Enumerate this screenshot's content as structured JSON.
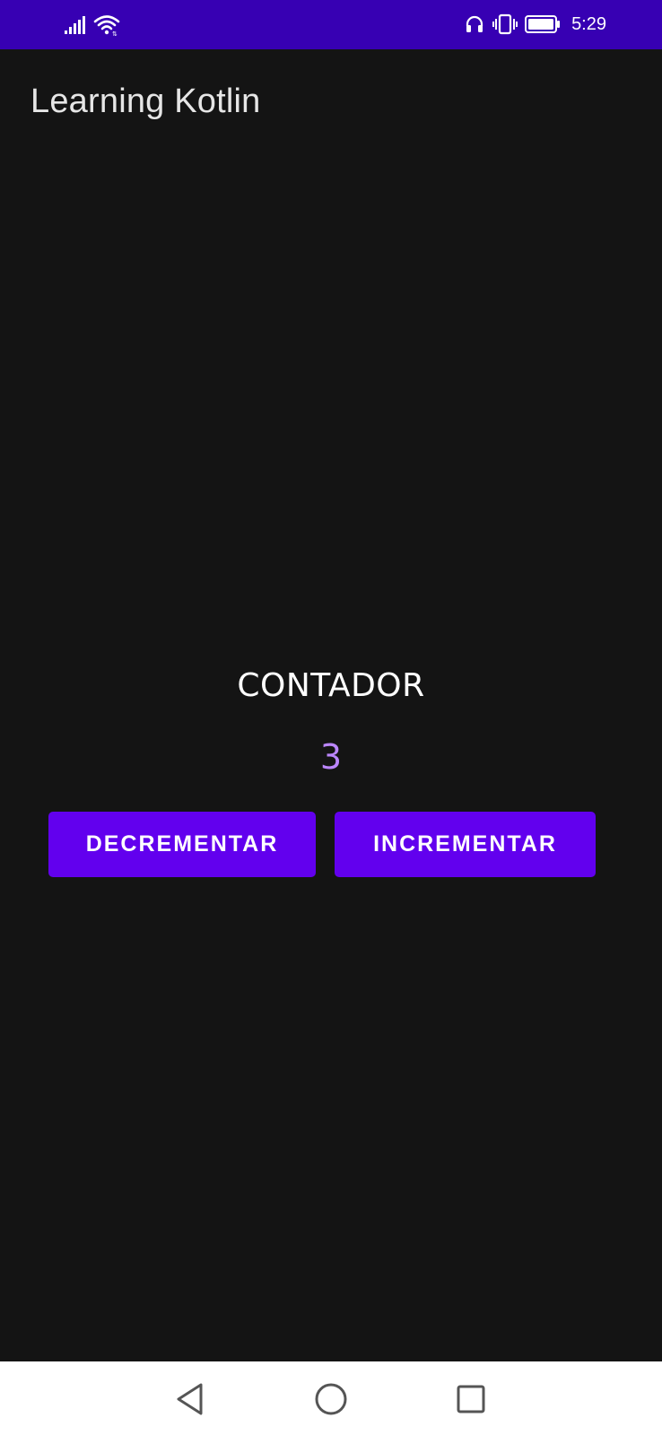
{
  "status_bar": {
    "time": "5:29",
    "signal_icon": "signal-bars-icon",
    "wifi_icon": "wifi-icon",
    "headset_icon": "headset-icon",
    "vibrate_icon": "vibrate-icon",
    "battery_icon": "battery-icon",
    "background_color": "#3700b3"
  },
  "app_bar": {
    "title": "Learning Kotlin"
  },
  "counter": {
    "label": "CONTADOR",
    "value": "3",
    "value_color": "#bb86fc"
  },
  "buttons": {
    "decrement_label": "DECREMENTAR",
    "increment_label": "INCREMENTAR",
    "color": "#6200ee"
  },
  "nav_bar": {
    "back_icon": "back-triangle-icon",
    "home_icon": "home-circle-icon",
    "recents_icon": "recents-square-icon"
  },
  "theme": {
    "background": "#141414"
  }
}
